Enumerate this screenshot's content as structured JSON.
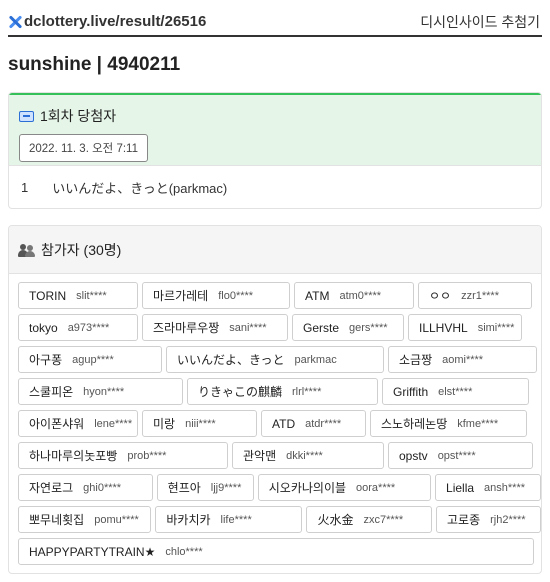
{
  "header": {
    "url": "dclottery.live/result/26516",
    "nav_link": "디시인사이드 추첨기"
  },
  "page_title": "sunshine | 4940211",
  "winner_card": {
    "title": "1회차 당첨자",
    "date": "2022. 11. 3. 오전 7:11",
    "winners": [
      {
        "rank": "1",
        "name": "いいんだよ、きっと(parkmac)"
      }
    ]
  },
  "participants_card": {
    "title": "참가자 (30명)",
    "rows": [
      [
        {
          "nick": "TORIN",
          "id": "slit****"
        },
        {
          "nick": "마르가레테",
          "id": "flo0****"
        },
        {
          "nick": "ATM",
          "id": "atm0****"
        },
        {
          "nick": "ㅇㅇ",
          "id": "zzr1****"
        }
      ],
      [
        {
          "nick": "tokyo",
          "id": "a973****"
        },
        {
          "nick": "즈라마루우짱",
          "id": "sani****"
        },
        {
          "nick": "Gerste",
          "id": "gers****"
        },
        {
          "nick": "ILLHVHL",
          "id": "simi****"
        }
      ],
      [
        {
          "nick": "아구퐁",
          "id": "agup****"
        },
        {
          "nick": "いいんだよ、きっと",
          "id": "parkmac"
        },
        {
          "nick": "소금짱",
          "id": "aomi****"
        }
      ],
      [
        {
          "nick": "스쿨피온",
          "id": "hyon****"
        },
        {
          "nick": "りきゃこの麒麟",
          "id": "rlrl****"
        },
        {
          "nick": "Griffith",
          "id": "elst****"
        }
      ],
      [
        {
          "nick": "아이폰샤워",
          "id": "lene****"
        },
        {
          "nick": "미랑",
          "id": "niii****"
        },
        {
          "nick": "ATD",
          "id": "atdr****"
        },
        {
          "nick": "스노하레논땅",
          "id": "kfme****"
        }
      ],
      [
        {
          "nick": "하나마루의놋포빵",
          "id": "prob****"
        },
        {
          "nick": "관악맨",
          "id": "dkki****"
        },
        {
          "nick": "opstv",
          "id": "opst****"
        }
      ],
      [
        {
          "nick": "자연로그",
          "id": "ghi0****"
        },
        {
          "nick": "현프아",
          "id": "ljj9****"
        },
        {
          "nick": "시오카나의이블",
          "id": "oora****"
        },
        {
          "nick": "Liella",
          "id": "ansh****"
        }
      ],
      [
        {
          "nick": "뽀무네횟집",
          "id": "pomu****"
        },
        {
          "nick": "바카치카",
          "id": "life****"
        },
        {
          "nick": "火水金",
          "id": "zxc7****"
        },
        {
          "nick": "고로종",
          "id": "rjh2****"
        }
      ],
      [
        {
          "nick": "HAPPYPARTYTRAIN★",
          "id": "chlo****"
        }
      ]
    ]
  }
}
